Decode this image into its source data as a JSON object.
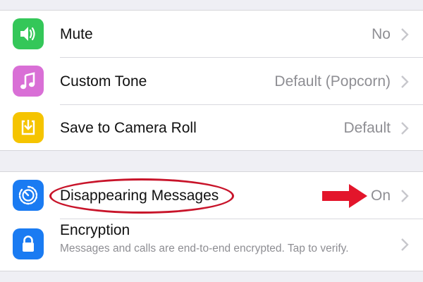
{
  "settings": {
    "rows": [
      {
        "label": "Mute",
        "value": "No",
        "icon": "speaker-icon",
        "icon_color": "#34c759"
      },
      {
        "label": "Custom Tone",
        "value": "Default (Popcorn)",
        "icon": "music-note-icon",
        "icon_color": "#d96fd6"
      },
      {
        "label": "Save to Camera Roll",
        "value": "Default",
        "icon": "download-icon",
        "icon_color": "#f5c400"
      },
      {
        "label": "Disappearing Messages",
        "value": "On",
        "icon": "timer-icon",
        "icon_color": "#1a7bf2"
      },
      {
        "label": "Encryption",
        "subtitle": "Messages and calls are end-to-end encrypted. Tap to verify.",
        "icon": "lock-icon",
        "icon_color": "#1a7bf2"
      }
    ]
  },
  "annotation": {
    "highlight_color": "#c8142a",
    "arrow_color": "#e3152b"
  }
}
